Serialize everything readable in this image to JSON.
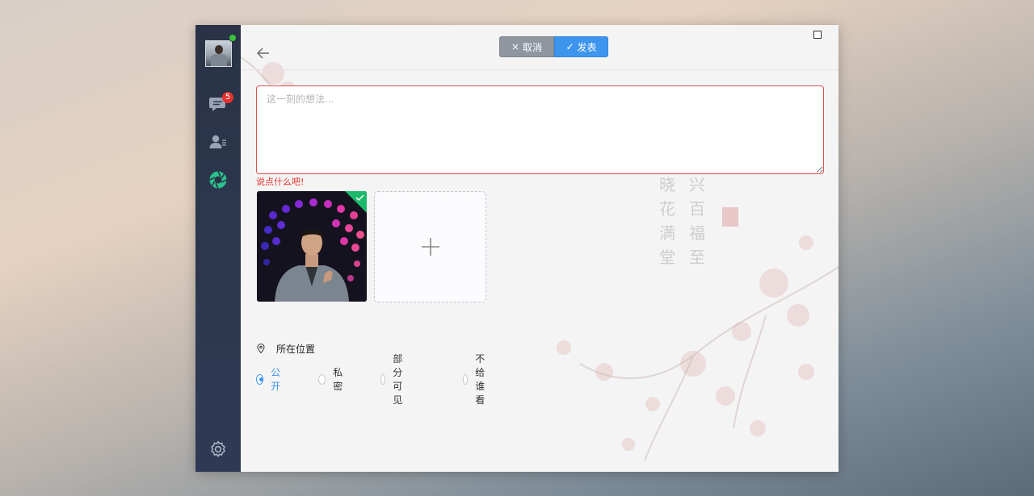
{
  "colors": {
    "sidebar": "#2a3346",
    "accent": "#3d95ee",
    "error": "#e5322d",
    "online": "#3bc13b",
    "cancel_button": "#8f969f"
  },
  "sidebar": {
    "avatar_icon": "user-avatar",
    "status_icon": "online-status-dot",
    "items": [
      {
        "icon": "chat-bubble-icon",
        "badge": "5"
      },
      {
        "icon": "contacts-icon"
      },
      {
        "icon": "moments-shutter-icon"
      }
    ],
    "settings_icon": "gear-icon"
  },
  "toolbar": {
    "back_icon": "back-arrow-icon",
    "cancel_label": "取消",
    "cancel_icon": "×",
    "publish_label": "发表",
    "publish_icon": "✓",
    "maximize_icon": "window-maximize-icon"
  },
  "composer": {
    "placeholder": "这一刻的想法...",
    "value": "",
    "error": "说点什么吧!"
  },
  "media": {
    "photos": [
      {
        "name": "stage-photo",
        "selected": true
      }
    ],
    "add_icon": "plus-icon"
  },
  "location": {
    "icon": "location-pin-icon",
    "label": "所在位置"
  },
  "visibility": {
    "selected": 0,
    "options": [
      "公开",
      "私密",
      "部分可见",
      "不给谁看"
    ]
  }
}
